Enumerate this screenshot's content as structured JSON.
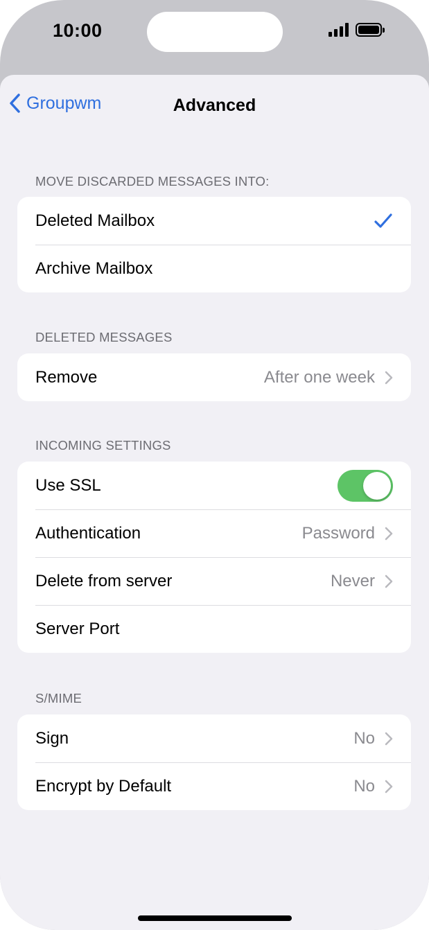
{
  "status_bar": {
    "time": "10:00"
  },
  "nav": {
    "back_label": "Groupwm",
    "title": "Advanced"
  },
  "sections": {
    "discarded": {
      "header": "MOVE DISCARDED MESSAGES INTO:",
      "rows": [
        {
          "label": "Deleted Mailbox",
          "selected": true
        },
        {
          "label": "Archive Mailbox",
          "selected": false
        }
      ]
    },
    "deleted": {
      "header": "DELETED MESSAGES",
      "rows": [
        {
          "label": "Remove",
          "value": "After one week"
        }
      ]
    },
    "incoming": {
      "header": "INCOMING SETTINGS",
      "rows": [
        {
          "label": "Use SSL",
          "toggle_on": true
        },
        {
          "label": "Authentication",
          "value": "Password"
        },
        {
          "label": "Delete from server",
          "value": "Never"
        },
        {
          "label": "Server Port",
          "value": ""
        }
      ]
    },
    "smime": {
      "header": "S/MIME",
      "rows": [
        {
          "label": "Sign",
          "value": "No"
        },
        {
          "label": "Encrypt by Default",
          "value": "No"
        }
      ]
    }
  },
  "colors": {
    "accent": "#2f6fdf",
    "toggle_on": "#5dc466",
    "background": "#f1f0f5"
  },
  "icons": {
    "back": "chevron-left-icon",
    "disclosure": "chevron-right-icon",
    "selected": "checkmark-icon"
  }
}
